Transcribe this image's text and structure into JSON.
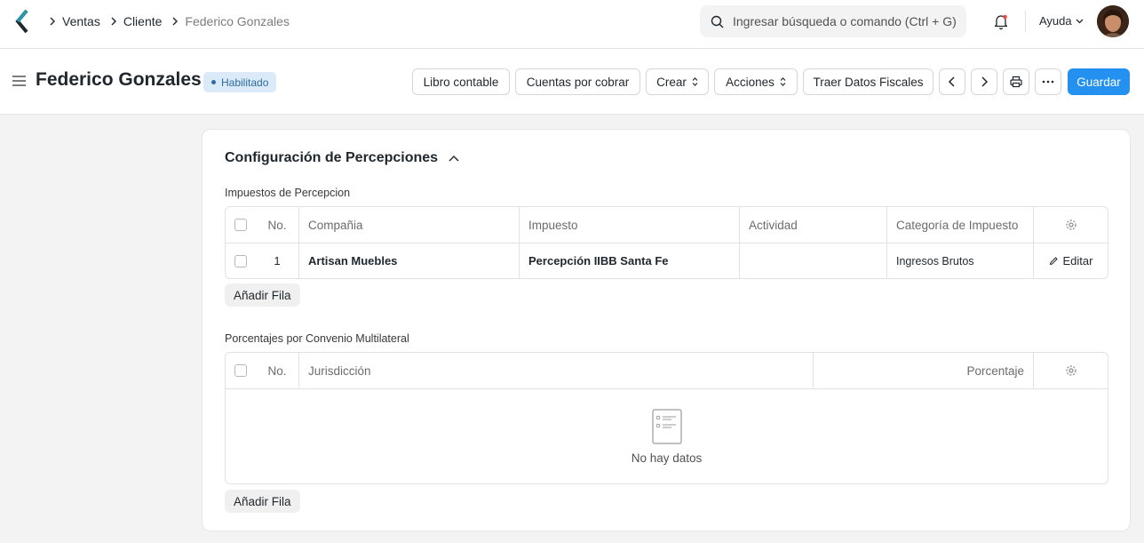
{
  "breadcrumbs": [
    "Ventas",
    "Cliente",
    "Federico Gonzales"
  ],
  "search": {
    "placeholder": "Ingresar búsqueda o comando (Ctrl + G)"
  },
  "help_label": "Ayuda",
  "page": {
    "title": "Federico Gonzales",
    "status": "Habilitado",
    "buttons": {
      "ledger": "Libro contable",
      "receivables": "Cuentas por cobrar",
      "create": "Crear",
      "actions": "Acciones",
      "fiscal": "Traer Datos Fiscales",
      "save": "Guardar"
    }
  },
  "section": {
    "title": "Configuración de Percepciones",
    "taxes_table": {
      "label": "Impuestos de Percepcion",
      "columns": [
        "No.",
        "Compañia",
        "Impuesto",
        "Actividad",
        "Categoría de Impuesto"
      ],
      "rows": [
        {
          "no": "1",
          "company": "Artisan Muebles",
          "tax": "Percepción IIBB Santa Fe",
          "activity": "",
          "category": "Ingresos Brutos"
        }
      ],
      "edit_label": "Editar",
      "add_row": "Añadir Fila"
    },
    "percent_table": {
      "label": "Porcentajes por Convenio Multilateral",
      "columns": [
        "No.",
        "Jurisdicción",
        "Porcentaje"
      ],
      "empty_text": "No hay datos",
      "add_row": "Añadir Fila"
    }
  },
  "colors": {
    "primary": "#2490ef",
    "badge_bg": "#dbeaf8",
    "badge_text": "#2d6ca3"
  }
}
